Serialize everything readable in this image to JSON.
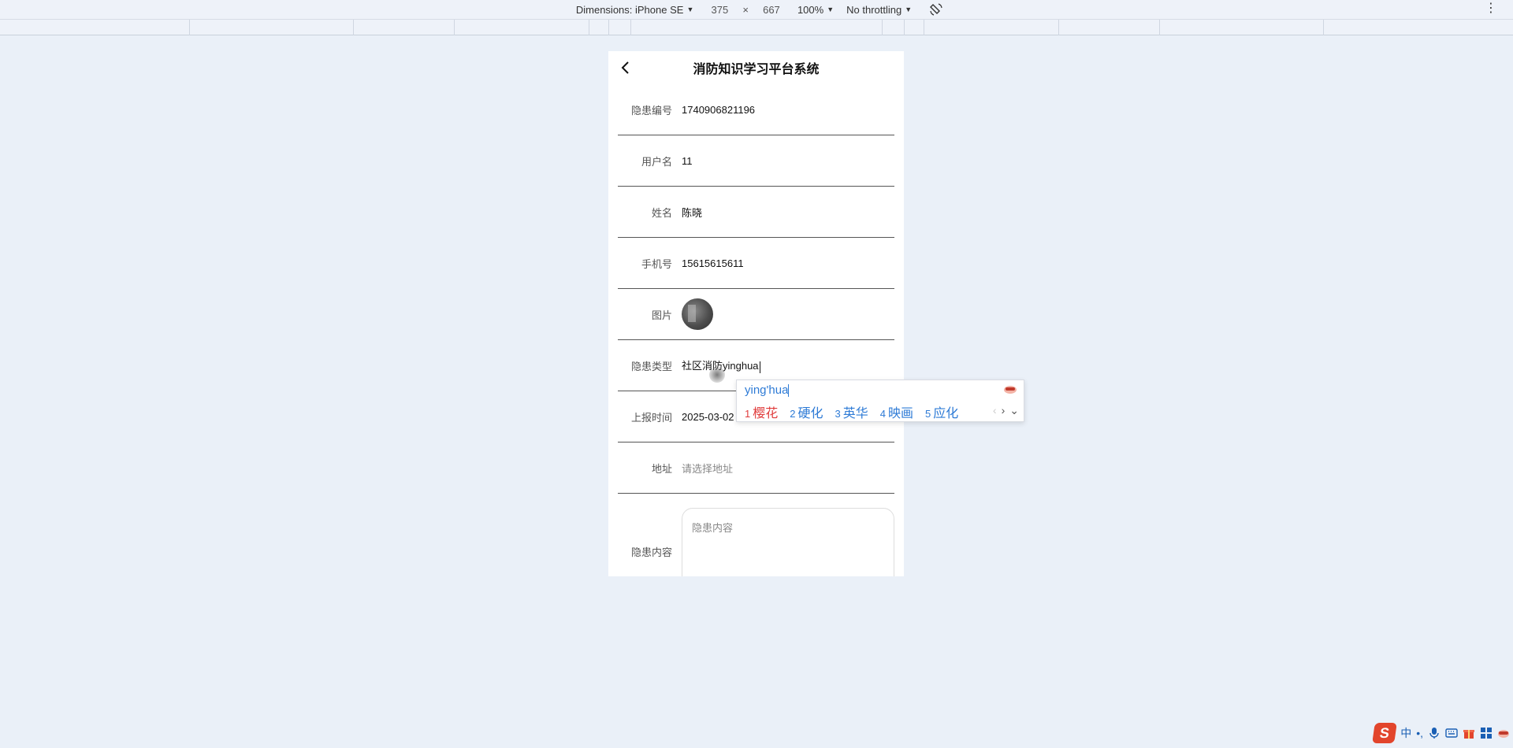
{
  "devtools": {
    "dimensions_label": "Dimensions: iPhone SE",
    "width": "375",
    "times": "×",
    "height": "667",
    "zoom": "100%",
    "throttling": "No throttling"
  },
  "app": {
    "title": "消防知识学习平台系统"
  },
  "form": {
    "rows": [
      {
        "label": "隐患编号",
        "value": "1740906821196"
      },
      {
        "label": "用户名",
        "value": "11"
      },
      {
        "label": "姓名",
        "value": "陈晓"
      },
      {
        "label": "手机号",
        "value": "15615615611"
      },
      {
        "label": "图片",
        "value": ""
      },
      {
        "label": "隐患类型",
        "value": "社区消防yinghua"
      },
      {
        "label": "上报时间",
        "value": "2025-03-02 17:13:41"
      },
      {
        "label": "地址",
        "placeholder": "请选择地址"
      },
      {
        "label": "隐患内容",
        "placeholder": "隐患内容"
      }
    ]
  },
  "ime": {
    "composition": "ying'hua",
    "candidates": [
      {
        "num": "1",
        "text": "樱花"
      },
      {
        "num": "2",
        "text": "硬化"
      },
      {
        "num": "3",
        "text": "英华"
      },
      {
        "num": "4",
        "text": "映画"
      },
      {
        "num": "5",
        "text": "应化"
      }
    ]
  },
  "tray": {
    "ime_mode": "中",
    "punct": "•,"
  },
  "colors": {
    "background": "#eaf0f8",
    "ime_accent": "#2e7bd6",
    "ime_first": "#e03b3b"
  }
}
